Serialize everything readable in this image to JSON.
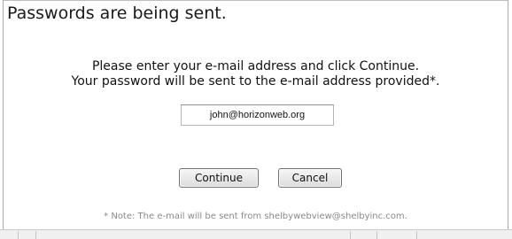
{
  "dialog": {
    "title": "Passwords are being sent.",
    "instruction_line1": "Please enter your e-mail address and click Continue.",
    "instruction_line2": "Your password will be sent to the e-mail address provided*.",
    "email_value": "john@horizonweb.org",
    "continue_label": "Continue",
    "cancel_label": "Cancel",
    "note": "* Note: The e-mail will be sent from shelbywebview@shelbyinc.com."
  }
}
